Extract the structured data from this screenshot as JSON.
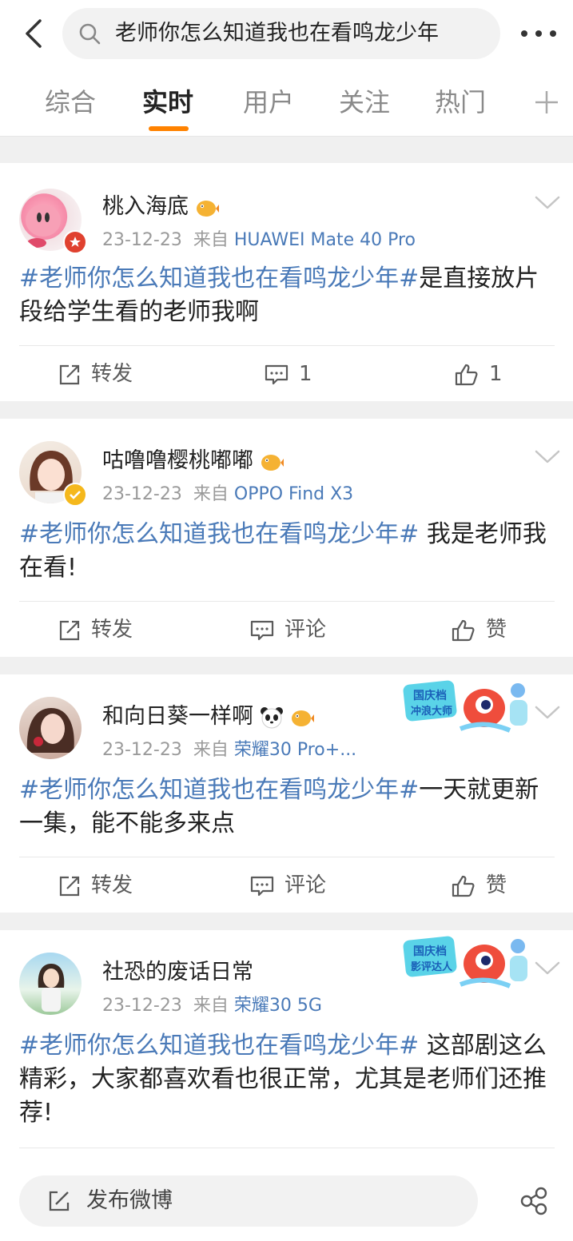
{
  "search": {
    "query": "老师你怎么知道我也在看鸣龙少年"
  },
  "tabs": [
    "综合",
    "实时",
    "用户",
    "关注",
    "热门"
  ],
  "bottom": {
    "compose_label": "发布微博"
  },
  "posts": [
    {
      "username": "桃入海底",
      "date": "23-12-23",
      "from_label": "来自",
      "source": "HUAWEI Mate 40 Pro",
      "topic": "#老师你怎么知道我也在看鸣龙少年#",
      "text": "是直接放片段给学生看的老师我啊",
      "repost": "转发",
      "comment": "1",
      "like": "1"
    },
    {
      "username": "咕噜噜樱桃嘟嘟",
      "date": "23-12-23",
      "from_label": "来自",
      "source": "OPPO Find X3",
      "topic": "#老师你怎么知道我也在看鸣龙少年#",
      "text": " 我是老师我在看!",
      "repost": "转发",
      "comment": "评论",
      "like": "赞"
    },
    {
      "username": "和向日葵一样啊",
      "date": "23-12-23",
      "from_label": "来自",
      "source": "荣耀30 Pro+...",
      "topic": "#老师你怎么知道我也在看鸣龙少年#",
      "text": "一天就更新一集，能不能多来点",
      "medal": [
        "国庆档",
        "冲浪大师"
      ],
      "repost": "转发",
      "comment": "评论",
      "like": "赞"
    },
    {
      "username": "社恐的废话日常",
      "date": "23-12-23",
      "from_label": "来自",
      "source": "荣耀30 5G",
      "topic": "#老师你怎么知道我也在看鸣龙少年#",
      "text": " 这部剧这么精彩，大家都喜欢看也很正常，尤其是老师们还推荐!",
      "medal": [
        "国庆档",
        "影评达人"
      ]
    }
  ],
  "colors": {
    "accent": "#ff8200",
    "link": "#4a7ab8",
    "vip_gold": "#f5b81c",
    "official_red": "#e0412f"
  },
  "icons": [
    "back-arrow-icon",
    "search-icon",
    "more-icon",
    "plus-icon",
    "chevron-down-icon",
    "repost-icon",
    "comment-icon",
    "like-icon",
    "compose-icon",
    "share-icon",
    "puffer-fish-icon",
    "panda-icon"
  ]
}
